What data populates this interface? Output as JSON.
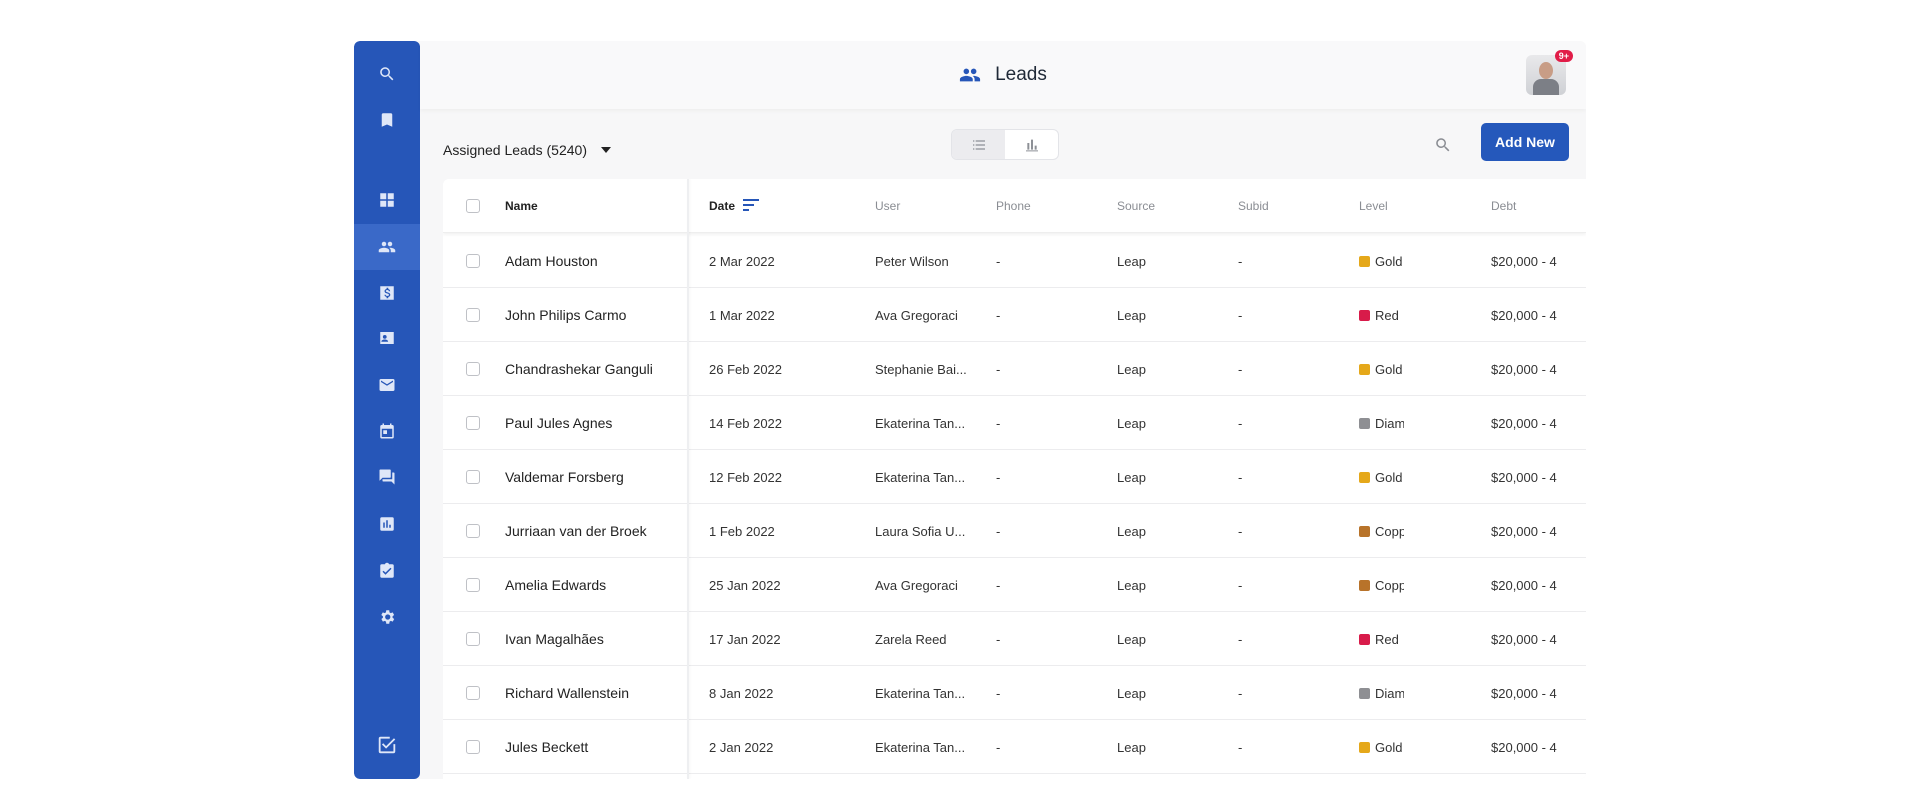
{
  "header": {
    "title": "Leads",
    "notification_badge": "9+"
  },
  "toolbar": {
    "assigned_label": "Assigned Leads (5240)",
    "add_new_label": "Add New"
  },
  "sidebar": {
    "items": [
      {
        "icon": "search-icon"
      },
      {
        "icon": "bookmark-icon"
      },
      {
        "icon": "dashboard-icon"
      },
      {
        "icon": "leads-icon",
        "active": true
      },
      {
        "icon": "dollar-icon"
      },
      {
        "icon": "contact-card-icon"
      },
      {
        "icon": "mail-icon"
      },
      {
        "icon": "calendar-icon"
      },
      {
        "icon": "chat-icon"
      },
      {
        "icon": "reports-icon"
      },
      {
        "icon": "clipboard-check-icon"
      },
      {
        "icon": "settings-icon"
      }
    ],
    "bottom_icon": "tasks-check-icon"
  },
  "table": {
    "columns": {
      "name": "Name",
      "date": "Date",
      "user": "User",
      "phone": "Phone",
      "source": "Source",
      "subid": "Subid",
      "level": "Level",
      "debt": "Debt"
    },
    "rows": [
      {
        "name": "Adam Houston",
        "date": "2 Mar 2022",
        "user": "Peter Wilson",
        "phone": "-",
        "source": "Leap",
        "subid": "-",
        "level": "Gold",
        "level_color": "#e5a81a",
        "debt": "$20,000 - 4"
      },
      {
        "name": "John Philips Carmo",
        "date": "1 Mar 2022",
        "user": "Ava Gregoraci",
        "phone": "-",
        "source": "Leap",
        "subid": "-",
        "level": "Red",
        "level_color": "#d81b4a",
        "debt": "$20,000 - 4"
      },
      {
        "name": "Chandrashekar Ganguli",
        "date": "26 Feb 2022",
        "user": "Stephanie Bai...",
        "phone": "-",
        "source": "Leap",
        "subid": "-",
        "level": "Gold",
        "level_color": "#e5a81a",
        "debt": "$20,000 - 4"
      },
      {
        "name": "Paul Jules Agnes",
        "date": "14 Feb 2022",
        "user": "Ekaterina Tan...",
        "phone": "-",
        "source": "Leap",
        "subid": "-",
        "level": "Diam",
        "level_color": "#8e8f93",
        "debt": "$20,000 - 4"
      },
      {
        "name": "Valdemar Forsberg",
        "date": "12 Feb 2022",
        "user": "Ekaterina Tan...",
        "phone": "-",
        "source": "Leap",
        "subid": "-",
        "level": "Gold",
        "level_color": "#e5a81a",
        "debt": "$20,000 - 4"
      },
      {
        "name": "Jurriaan van der Broek",
        "date": "1 Feb 2022",
        "user": "Laura Sofia U...",
        "phone": "-",
        "source": "Leap",
        "subid": "-",
        "level": "Copp",
        "level_color": "#b8732a",
        "debt": "$20,000 - 4"
      },
      {
        "name": "Amelia Edwards",
        "date": "25 Jan 2022",
        "user": "Ava Gregoraci",
        "phone": "-",
        "source": "Leap",
        "subid": "-",
        "level": "Copp",
        "level_color": "#b8732a",
        "debt": "$20,000 - 4"
      },
      {
        "name": "Ivan Magalhães",
        "date": "17 Jan 2022",
        "user": "Zarela Reed",
        "phone": "-",
        "source": "Leap",
        "subid": "-",
        "level": "Red",
        "level_color": "#d81b4a",
        "debt": "$20,000 - 4"
      },
      {
        "name": "Richard Wallenstein",
        "date": "8 Jan 2022",
        "user": "Ekaterina Tan...",
        "phone": "-",
        "source": "Leap",
        "subid": "-",
        "level": "Diam",
        "level_color": "#8e8f93",
        "debt": "$20,000 - 4"
      },
      {
        "name": "Jules Beckett",
        "date": "2 Jan 2022",
        "user": "Ekaterina Tan...",
        "phone": "-",
        "source": "Leap",
        "subid": "-",
        "level": "Gold",
        "level_color": "#e5a81a",
        "debt": "$20,000 - 4"
      }
    ]
  },
  "colors": {
    "brand": "#2656b8",
    "button": "#2558bb"
  }
}
